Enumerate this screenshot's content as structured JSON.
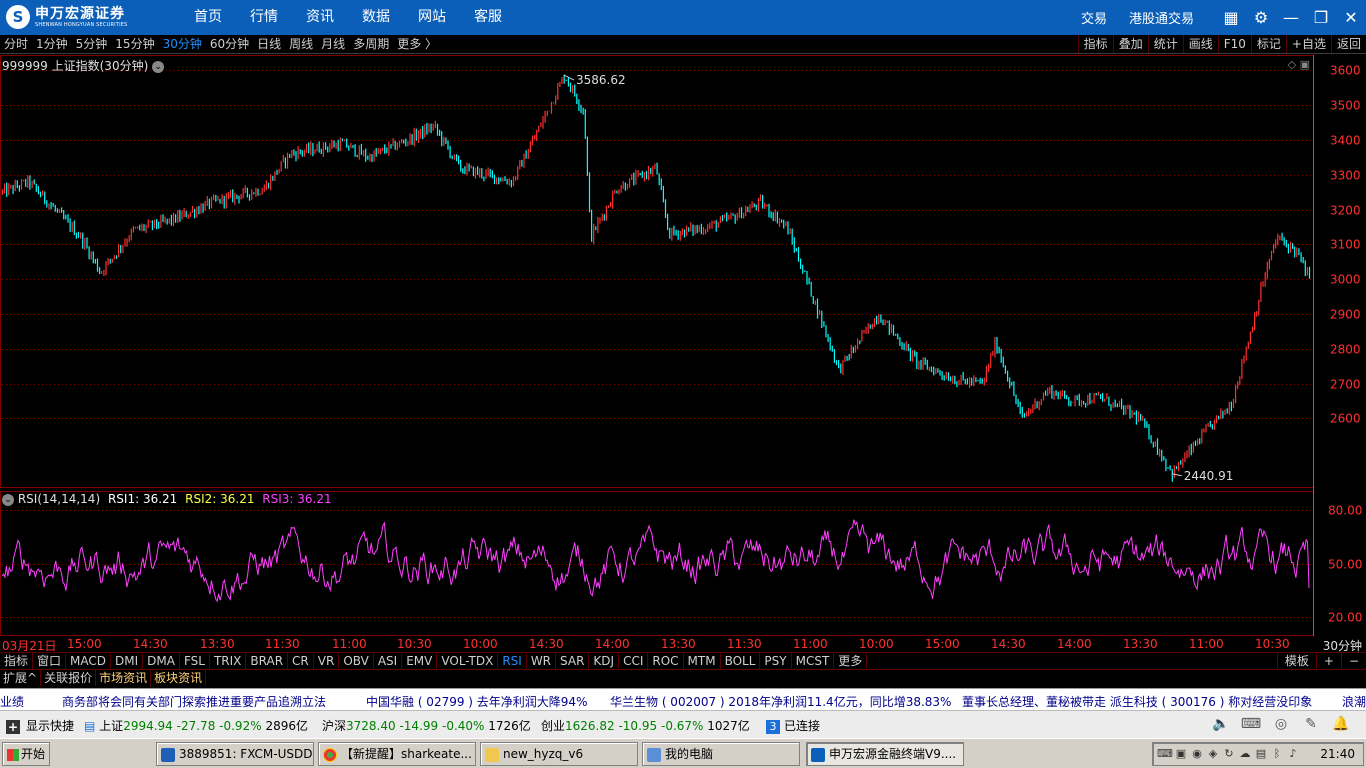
{
  "titlebar": {
    "logo_text": "申万宏源证券",
    "logo_sub": "SHENWAN HONGYUAN SECURITIES",
    "nav": [
      "首页",
      "行情",
      "资讯",
      "数据",
      "网站",
      "客服"
    ],
    "right_links": [
      "交易",
      "港股通交易"
    ],
    "icons": [
      "grid-icon",
      "gear-icon",
      "minimize-icon",
      "restore-icon",
      "close-icon"
    ]
  },
  "periods": [
    "分时",
    "1分钟",
    "5分钟",
    "15分钟",
    "30分钟",
    "60分钟",
    "日线",
    "周线",
    "月线",
    "多周期",
    "更多 〉"
  ],
  "active_period": "30分钟",
  "tools": [
    "指标",
    "叠加",
    "统计",
    "画线",
    "F10",
    "标记",
    "+自选",
    "返回"
  ],
  "main_chart": {
    "label": "999999 上证指数(30分钟)",
    "high_label": "3586.62",
    "low_label": "2440.91"
  },
  "rsi": {
    "name": "RSI(14,14,14)",
    "rsi1": "RSI1: 36.21",
    "rsi2": "RSI2: 36.21",
    "rsi3": "RSI3: 36.21"
  },
  "x_labels": [
    "03月21日",
    "15:00",
    "14:30",
    "13:30",
    "11:30",
    "11:00",
    "10:30",
    "10:00",
    "14:30",
    "14:00",
    "13:30",
    "11:30",
    "11:00",
    "10:00",
    "15:00",
    "14:30",
    "14:00",
    "13:30",
    "11:00",
    "10:30"
  ],
  "period_tag": "30分钟",
  "indicator_tabs": [
    "指标",
    "窗口",
    "MACD",
    "DMI",
    "DMA",
    "FSL",
    "TRIX",
    "BRAR",
    "CR",
    "VR",
    "OBV",
    "ASI",
    "EMV",
    "VOL-TDX",
    "RSI",
    "WR",
    "SAR",
    "KDJ",
    "CCI",
    "ROC",
    "MTM",
    "BOLL",
    "PSY",
    "MCST",
    "更多"
  ],
  "active_indicator": "RSI",
  "indicator_right": [
    "模板",
    "+",
    "−"
  ],
  "info_tabs": [
    "扩展^",
    "关联报价",
    "市场资讯",
    "板块资讯"
  ],
  "ticker": [
    "业绩",
    "商务部将会同有关部门探索推进重要产品追溯立法",
    "中国华融 ( 02799 ) 去年净利润大降94%",
    "华兰生物 ( 002007 ) 2018年净利润11.4亿元，同比增38.83%",
    "董事长总经理、董秘被带走  派生科技 ( 300176 ) 称对经营没印象",
    "浪潮"
  ],
  "status": {
    "show_shortcut": "显示快捷",
    "sh": {
      "name": "上证",
      "price": "2994.94",
      "chg": "-27.78",
      "pct": "-0.92%",
      "amt": "2896亿"
    },
    "sz": {
      "name": "沪深",
      "price": "3728.40",
      "chg": "-14.99",
      "pct": "-0.40%",
      "amt": "1726亿"
    },
    "cy": {
      "name": "创业",
      "price": "1626.82",
      "chg": "-10.95",
      "pct": "-0.67%",
      "amt": "1027亿"
    },
    "conn_count": "3",
    "conn_text": "已连接"
  },
  "taskbar": {
    "start": "开始",
    "tasks": [
      "3889851: FXCM-USDDe...",
      "【新提醒】sharkeate...",
      "new_hyzq_v6",
      "我的电脑",
      "申万宏源金融终端V9...."
    ],
    "clock": "21:40"
  },
  "chart_data": [
    {
      "type": "line",
      "title": "999999 上证指数(30分钟)",
      "ylim": [
        2400,
        3630
      ],
      "yticks": [
        2600,
        2700,
        2800,
        2900,
        3000,
        3100,
        3200,
        3300,
        3400,
        3500,
        3600
      ],
      "anchors": [
        [
          0,
          3250
        ],
        [
          0.02,
          3280
        ],
        [
          0.04,
          3200
        ],
        [
          0.06,
          3120
        ],
        [
          0.075,
          3020
        ],
        [
          0.1,
          3140
        ],
        [
          0.13,
          3170
        ],
        [
          0.16,
          3220
        ],
        [
          0.2,
          3260
        ],
        [
          0.22,
          3360
        ],
        [
          0.26,
          3390
        ],
        [
          0.28,
          3350
        ],
        [
          0.31,
          3400
        ],
        [
          0.33,
          3440
        ],
        [
          0.35,
          3320
        ],
        [
          0.39,
          3280
        ],
        [
          0.41,
          3430
        ],
        [
          0.43,
          3586.62
        ],
        [
          0.445,
          3480
        ],
        [
          0.45,
          3120
        ],
        [
          0.47,
          3260
        ],
        [
          0.5,
          3320
        ],
        [
          0.51,
          3130
        ],
        [
          0.54,
          3150
        ],
        [
          0.56,
          3180
        ],
        [
          0.58,
          3220
        ],
        [
          0.6,
          3150
        ],
        [
          0.62,
          2950
        ],
        [
          0.64,
          2740
        ],
        [
          0.67,
          2900
        ],
        [
          0.7,
          2760
        ],
        [
          0.73,
          2710
        ],
        [
          0.75,
          2700
        ],
        [
          0.76,
          2820
        ],
        [
          0.78,
          2600
        ],
        [
          0.8,
          2680
        ],
        [
          0.82,
          2650
        ],
        [
          0.84,
          2660
        ],
        [
          0.87,
          2600
        ],
        [
          0.895,
          2440.91
        ],
        [
          0.92,
          2560
        ],
        [
          0.94,
          2640
        ],
        [
          0.955,
          2850
        ],
        [
          0.965,
          3000
        ],
        [
          0.975,
          3120
        ],
        [
          0.99,
          3080
        ],
        [
          1.0,
          3000
        ]
      ]
    },
    {
      "type": "line",
      "title": "RSI(14,14,14)",
      "ylim": [
        10,
        90
      ],
      "yticks": [
        20,
        50,
        80
      ],
      "series": [
        {
          "name": "RSI3",
          "last": 36.21
        }
      ]
    }
  ],
  "colors": {
    "up": "#ff3030",
    "down": "#00ffff",
    "grid": "#800000",
    "rsi": "#ff40ff",
    "axis_text": "#ff3030",
    "title_bg": "#0b5fb8"
  }
}
